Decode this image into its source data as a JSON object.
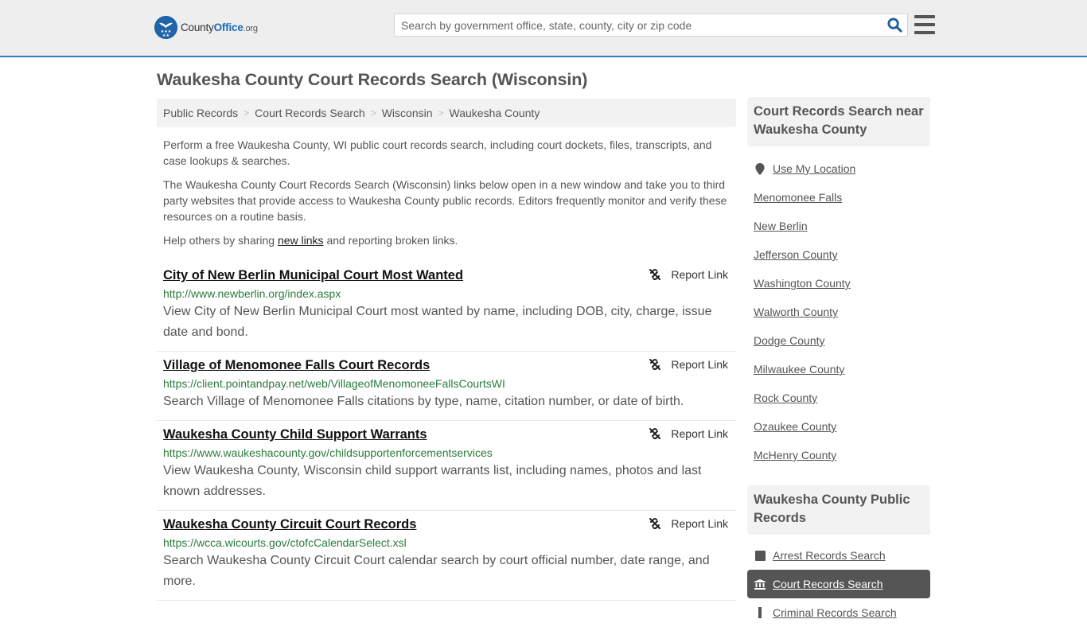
{
  "header": {
    "logo": {
      "county": "County",
      "office": "Office",
      "org": ".org"
    },
    "search_placeholder": "Search by government office, state, county, city or zip code",
    "search_value": ""
  },
  "page": {
    "title": "Waukesha County Court Records Search (Wisconsin)"
  },
  "breadcrumb": [
    {
      "label": "Public Records"
    },
    {
      "label": "Court Records Search"
    },
    {
      "label": "Wisconsin"
    },
    {
      "label": "Waukesha County"
    }
  ],
  "intro": {
    "p1": "Perform a free Waukesha County, WI public court records search, including court dockets, files, transcripts, and case lookups & searches.",
    "p2": "The Waukesha County Court Records Search (Wisconsin) links below open in a new window and take you to third party websites that provide access to Waukesha County public records. Editors frequently monitor and verify these resources on a routine basis.",
    "p3_before": "Help others by sharing ",
    "p3_link": "new links",
    "p3_after": " and reporting broken links."
  },
  "report_label": "Report Link",
  "results": [
    {
      "title": "City of New Berlin Municipal Court Most Wanted",
      "url": "http://www.newberlin.org/index.aspx",
      "description": "View City of New Berlin Municipal Court most wanted by name, including DOB, city, charge, issue date and bond."
    },
    {
      "title": "Village of Menomonee Falls Court Records",
      "url": "https://client.pointandpay.net/web/VillageofMenomoneeFallsCourtsWI",
      "description": "Search Village of Menomonee Falls citations by type, name, citation number, or date of birth."
    },
    {
      "title": "Waukesha County Child Support Warrants",
      "url": "https://www.waukeshacounty.gov/childsupportenforcementservices",
      "description": "View Waukesha County, Wisconsin child support warrants list, including names, photos and last known addresses."
    },
    {
      "title": "Waukesha County Circuit Court Records",
      "url": "https://wcca.wicourts.gov/ctofcCalendarSelect.xsl",
      "description": "Search Waukesha County Circuit Court calendar search by court official number, date range, and more."
    }
  ],
  "sidebar": {
    "near_heading": "Court Records Search near Waukesha County",
    "use_location": "Use My Location",
    "near_items": [
      "Menomonee Falls",
      "New Berlin",
      "Jefferson County",
      "Washington County",
      "Walworth County",
      "Dodge County",
      "Milwaukee County",
      "Rock County",
      "Ozaukee County",
      "McHenry County"
    ],
    "public_heading": "Waukesha County Public Records",
    "public_items": [
      {
        "label": "Arrest Records Search",
        "icon": "square-icon",
        "active": false
      },
      {
        "label": "Court Records Search",
        "icon": "courthouse-icon",
        "active": true
      },
      {
        "label": "Criminal Records Search",
        "icon": "bar-icon",
        "active": false
      }
    ]
  }
}
